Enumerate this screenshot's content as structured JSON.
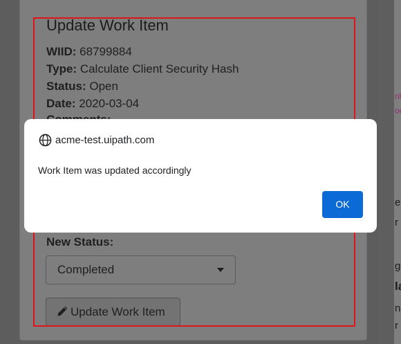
{
  "form": {
    "title": "Update Work Item",
    "fields": [
      {
        "label": "WIID:",
        "value": "68799884"
      },
      {
        "label": "Type:",
        "value": "Calculate Client Security Hash"
      },
      {
        "label": "Status:",
        "value": "Open"
      },
      {
        "label": "Date:",
        "value": "2020-03-04"
      },
      {
        "label": "Comments:",
        "value": ""
      }
    ],
    "new_status_label": "New Status:",
    "new_status_selected": "Completed",
    "update_button_label": "Update Work Item"
  },
  "right_panel_fragments": [
    "nl",
    "oc",
    "e",
    "r",
    "g",
    "la",
    "ne",
    "r"
  ],
  "dialog": {
    "origin": "acme-test.uipath.com",
    "message": "Work Item was updated accordingly",
    "ok_label": "OK"
  },
  "colors": {
    "highlight_box": "#e0131b",
    "ok_button": "#0b6ad6"
  },
  "icons": [
    "globe-icon",
    "pencil-icon",
    "caret-down-icon"
  ]
}
